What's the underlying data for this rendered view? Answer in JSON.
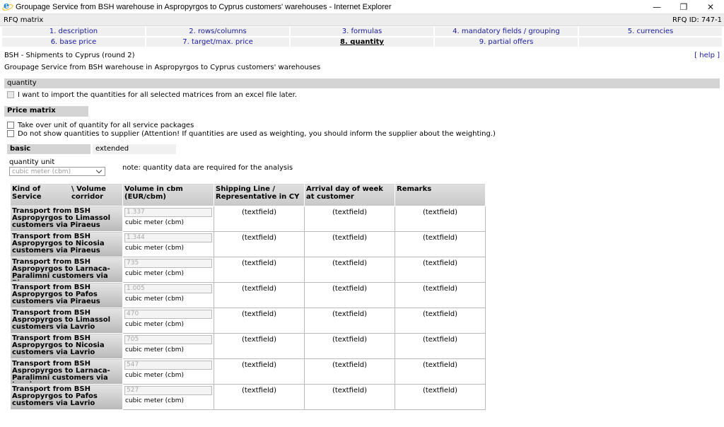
{
  "window": {
    "title": "Groupage Service from BSH warehouse in Aspropyrgos to Cyprus customers' warehouses - Internet Explorer",
    "minimize": "—",
    "restore": "❐",
    "close": "✕"
  },
  "subheader": {
    "left": "RFQ matrix",
    "right": "RFQ ID: 747-1"
  },
  "tabs": [
    {
      "label": "1. description"
    },
    {
      "label": "2. rows/columns"
    },
    {
      "label": "3. formulas"
    },
    {
      "label": "4. mandatory fields / grouping"
    },
    {
      "label": "5. currencies"
    },
    {
      "label": "6. base price"
    },
    {
      "label": "7. target/max. price"
    },
    {
      "label": "8. quantity"
    },
    {
      "label": "9. partial offers"
    },
    {
      "label": ""
    }
  ],
  "page": {
    "heading": "BSH - Shipments to Cyprus (round 2)",
    "help": "[ help ]",
    "subtitle": "Groupage Service from BSH warehouse in Aspropyrgos to Cyprus customers' warehouses"
  },
  "quantity_section": {
    "title": "quantity",
    "import_label": "I want to import the quantities for all selected matrices from an excel file later."
  },
  "price_matrix": {
    "title": "Price matrix",
    "takeover_label": "Take over unit of quantity for all service packages",
    "hide_label": "Do not show quantities to supplier (Attention! If quantities are used as weighting, you should inform the supplier about the weighting.)"
  },
  "subtabs": {
    "basic": "basic",
    "extended": "extended"
  },
  "unit": {
    "label": "quantity unit",
    "selected": "cubic meter (cbm)",
    "note": "note: quantity data are required for the analysis"
  },
  "table": {
    "headers": {
      "kind": "Kind of Service",
      "corridor": "\\ Volume corridor",
      "volume": "Volume in cbm (EUR/cbm)",
      "shipping": "Shipping Line / Representative in CY",
      "arrival": "Arrival day of week at customer",
      "remarks": "Remarks"
    },
    "textfield": "(textfield)",
    "rows": [
      {
        "service": "Transport from BSH Aspropyrgos to Limassol customers via Piraeus",
        "qty": "1.337",
        "unit": "cubic meter (cbm)"
      },
      {
        "service": "Transport from BSH Aspropyrgos to Nicosia customers via Piraeus",
        "qty": "1.344",
        "unit": "cubic meter (cbm)"
      },
      {
        "service": "Transport from BSH Aspropyrgos to Larnaca-Paralimni customers via Piraeus",
        "qty": "735",
        "unit": "cubic meter (cbm)"
      },
      {
        "service": "Transport from BSH Aspropyrgos to Pafos customers via Piraeus",
        "qty": "1.005",
        "unit": "cubic meter (cbm)"
      },
      {
        "service": "Transport from BSH Aspropyrgos to Limassol customers via Lavrio",
        "qty": "470",
        "unit": "cubic meter (cbm)"
      },
      {
        "service": "Transport from BSH Aspropyrgos to Nicosia customers via Lavrio",
        "qty": "705",
        "unit": "cubic meter (cbm)"
      },
      {
        "service": "Transport from BSH Aspropyrgos to Larnaca-Paralimni customers via Lavrio",
        "qty": "547",
        "unit": "cubic meter (cbm)"
      },
      {
        "service": "Transport from BSH Aspropyrgos to Pafos customers via Lavrio",
        "qty": "527",
        "unit": "cubic meter (cbm)"
      }
    ]
  }
}
